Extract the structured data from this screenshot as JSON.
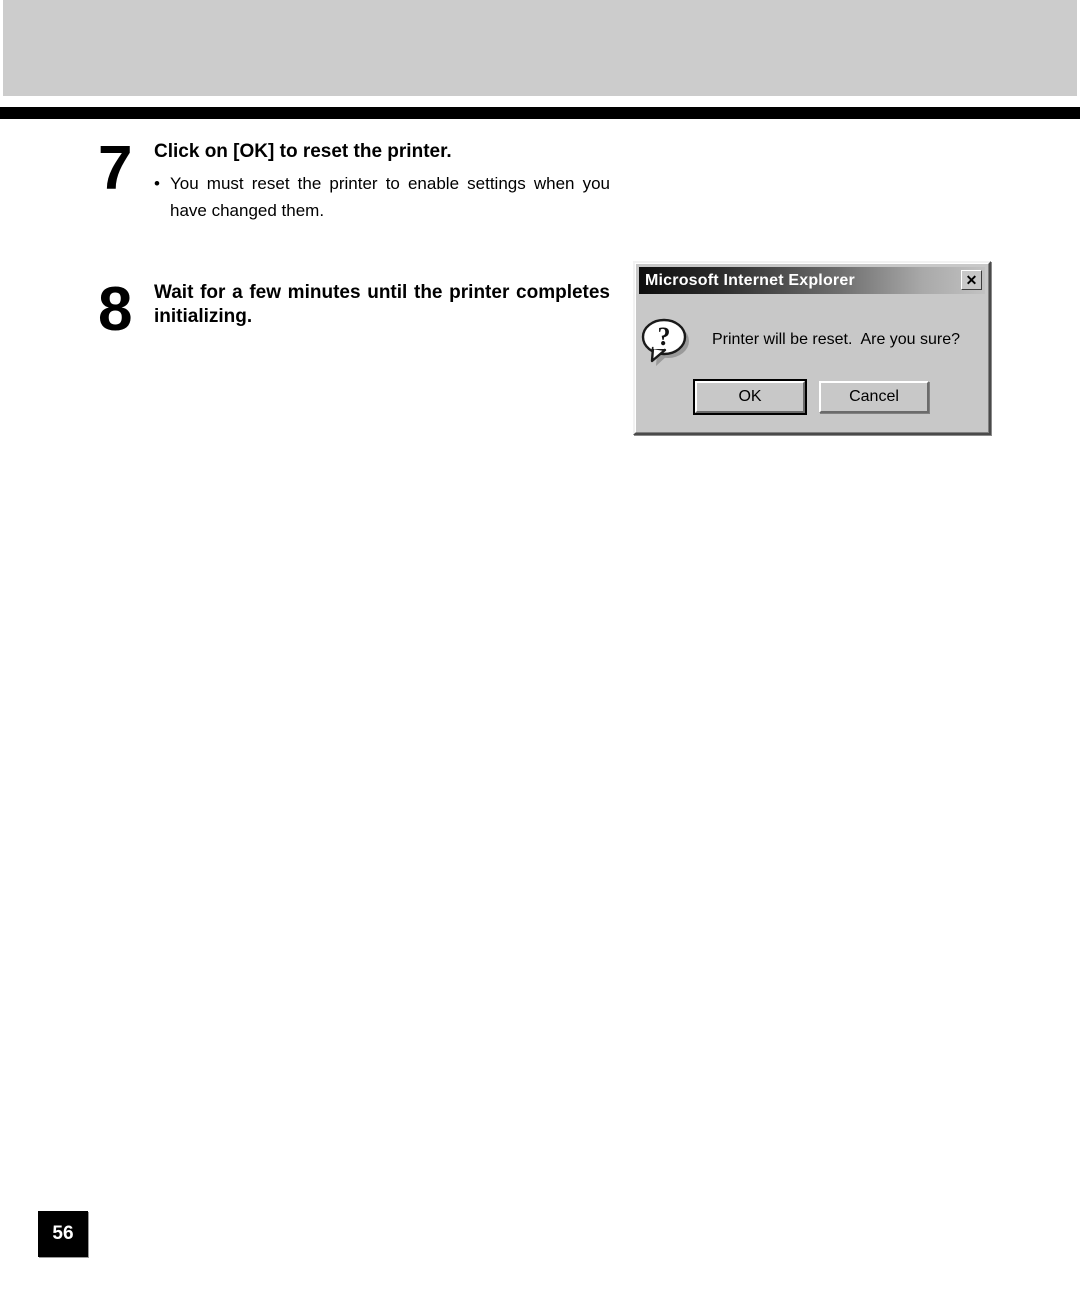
{
  "page": {
    "number": "56",
    "header_band_color": "#cccccc",
    "rule_color": "#000000"
  },
  "steps": [
    {
      "number": "7",
      "title": "Click on [OK] to reset the printer.",
      "notes": [
        {
          "bullet": "•",
          "text": "You must reset the printer to enable settings when you have changed them."
        }
      ]
    },
    {
      "number": "8",
      "title": "Wait for a few minutes until the printer completes initializing.",
      "notes": []
    }
  ],
  "dialog": {
    "title": "Microsoft Internet Explorer",
    "close_label": "✕",
    "icon": "question-bubble-icon",
    "message": "Printer will be reset.  Are you sure?",
    "buttons": [
      {
        "label": "OK",
        "default": true
      },
      {
        "label": "Cancel",
        "default": false
      }
    ]
  }
}
